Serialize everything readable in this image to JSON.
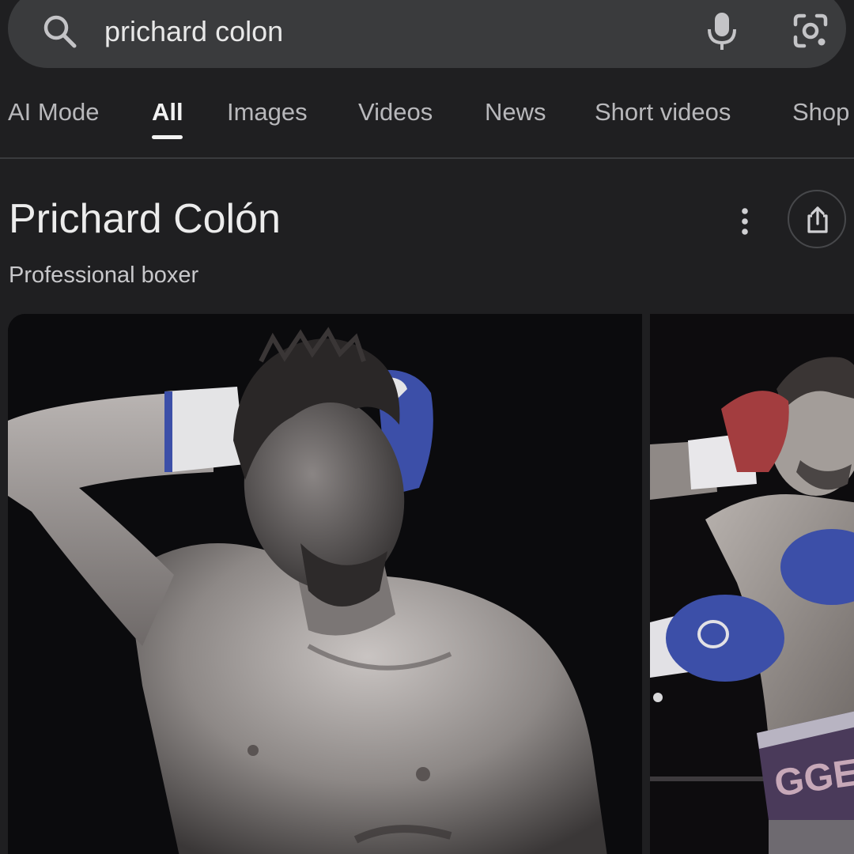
{
  "search": {
    "query": "prichard colon",
    "icons": {
      "search": "search-icon",
      "mic": "mic-icon",
      "lens": "google-lens-icon"
    }
  },
  "tabs": [
    {
      "label": "AI Mode",
      "active": false
    },
    {
      "label": "All",
      "active": true
    },
    {
      "label": "Images",
      "active": false
    },
    {
      "label": "Videos",
      "active": false
    },
    {
      "label": "News",
      "active": false
    },
    {
      "label": "Short videos",
      "active": false
    },
    {
      "label": "Shop",
      "active": false
    }
  ],
  "knowledge_panel": {
    "title": "Prichard Colón",
    "subtitle": "Professional boxer",
    "icons": {
      "more": "more-vert-icon",
      "share": "share-icon"
    }
  },
  "images": [
    {
      "name": "boxer-portrait-photo"
    },
    {
      "name": "boxer-fight-photo"
    }
  ],
  "colors": {
    "background": "#1f1f21",
    "search_bar": "#3a3b3d",
    "text_primary": "#ececec",
    "text_secondary": "#b8b8bb",
    "glove_blue": "#3c4fa8",
    "glove_red": "#a33d3f"
  }
}
